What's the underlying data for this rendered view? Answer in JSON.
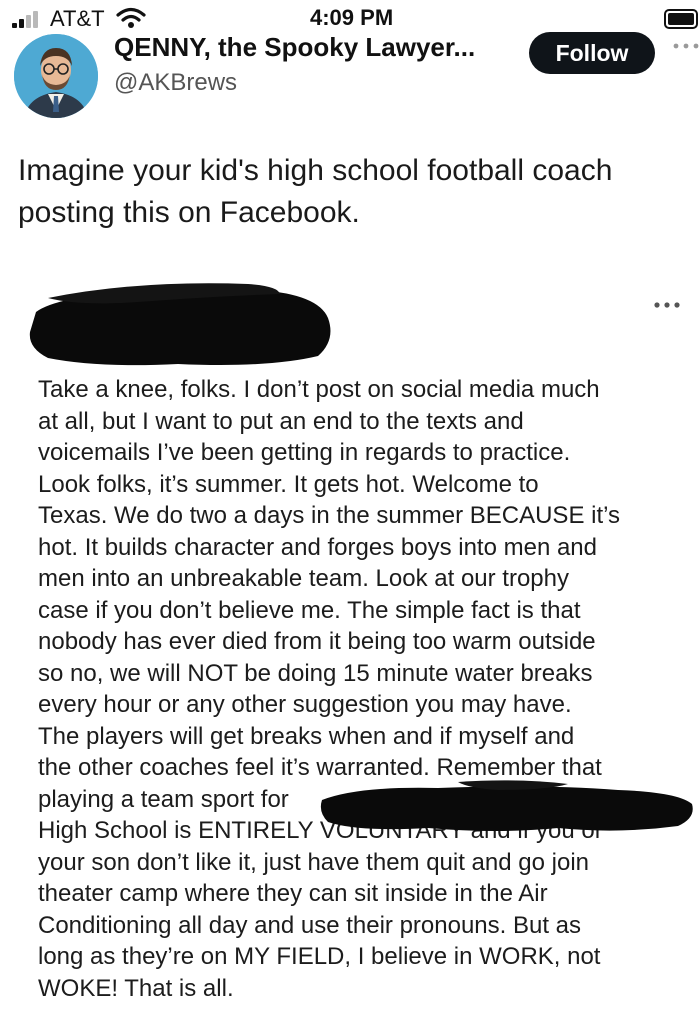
{
  "status_bar": {
    "carrier": "AT&T",
    "time": "4:09 PM",
    "signal_icon": "signal-bars-icon",
    "wifi_icon": "wifi-icon",
    "battery_icon": "battery-icon"
  },
  "tweet": {
    "display_name": "QENNY, the Spooky Lawyer...",
    "handle": "@AKBrews",
    "follow_label": "Follow",
    "text": "Imagine your kid's high school football coach posting this on Facebook."
  },
  "embedded_post": {
    "author_redacted": true,
    "lines": [
      "Take a knee, folks. I don’t post on social media much",
      "at all, but I want to put an end to the texts and",
      "voicemails I’ve been getting in regards to practice.",
      "Look folks, it’s summer. It gets hot. Welcome to",
      "Texas. We do two a days in the summer BECAUSE it’s",
      "hot. It builds character and forges boys into men and",
      "men into an unbreakable team. Look at our trophy",
      "case if you don’t believe me. The simple fact is that",
      "nobody has ever died from it being too warm outside",
      "so no, we will NOT be doing 15 minute water breaks",
      "every hour or any other suggestion you may have.",
      "The players will get breaks when and if myself and",
      "the other coaches feel it’s warranted. Remember that",
      "playing a team sport for",
      "High School is ENTIRELY VOLUNTARY and if you or",
      "your son don’t like it, just have them quit and go join",
      "theater camp where they can sit inside in the Air",
      "Conditioning all day and use their pronouns. But as",
      "long as they’re on MY FIELD, I believe in WORK, not",
      "WOKE! That is all."
    ]
  },
  "colors": {
    "follow_bg": "#0f1419",
    "follow_text": "#ffffff",
    "handle_text": "#555555",
    "redaction": "#0a0a0a"
  }
}
